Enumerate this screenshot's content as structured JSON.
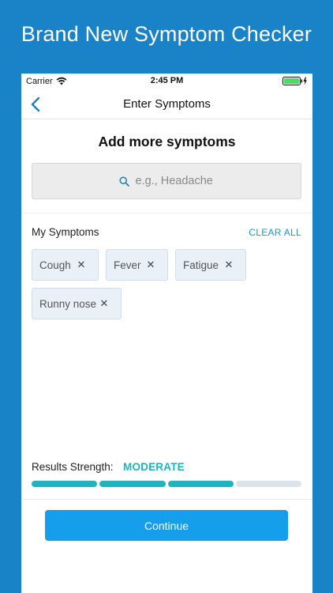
{
  "headline": "Brand New Symptom Checker",
  "status_bar": {
    "carrier": "Carrier",
    "time": "2:45 PM"
  },
  "nav": {
    "title": "Enter Symptoms"
  },
  "section_title": "Add more symptoms",
  "search": {
    "placeholder": "e.g., Headache"
  },
  "symptoms": {
    "label": "My Symptoms",
    "clear_all": "CLEAR ALL",
    "items": [
      {
        "label": "Cough"
      },
      {
        "label": "Fever"
      },
      {
        "label": "Fatigue"
      },
      {
        "label": "Runny nose"
      }
    ]
  },
  "results": {
    "label": "Results Strength:",
    "value": "MODERATE",
    "segments_total": 4,
    "segments_filled": 3
  },
  "continue_label": "Continue",
  "colors": {
    "background": "#1a82c6",
    "accent_teal": "#1fb4bf",
    "link_blue": "#1c98c7",
    "button_blue": "#159eeb"
  }
}
